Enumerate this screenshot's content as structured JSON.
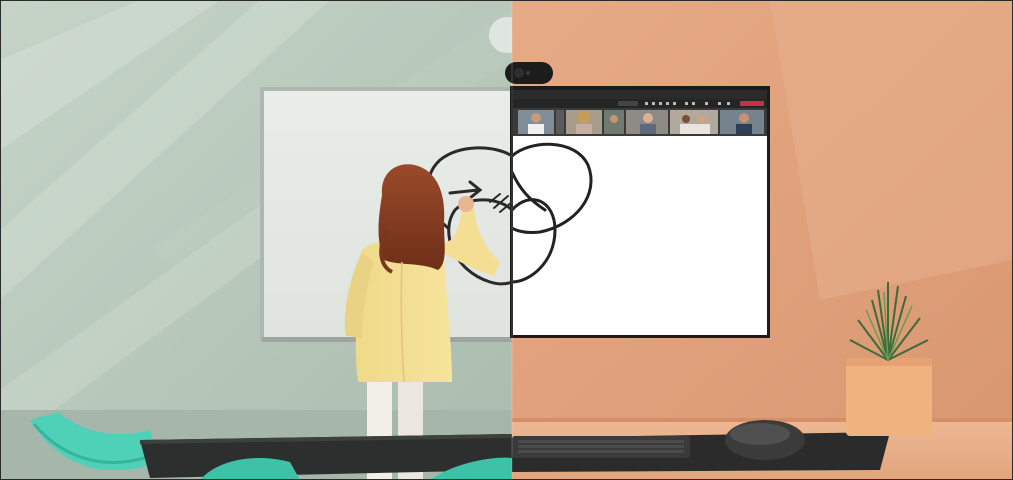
{
  "scene": {
    "left_room": {
      "wall_color": "#b8c9bc",
      "floor_color": "#aab9ae",
      "accent": "#4fd1b8"
    },
    "right_room": {
      "wall_color": "#e0a27c",
      "desk_color": "#e8b28e"
    },
    "meeting_window": {
      "participant_count": 7,
      "toolbar_icons": [
        "chat-icon",
        "people-icon",
        "reactions-icon",
        "view-icon",
        "more-icon",
        "camera-icon",
        "mic-icon",
        "share-icon"
      ]
    },
    "objects": [
      "whiteboard",
      "person-drawing",
      "conference-camera",
      "wall-monitor",
      "desk",
      "keyboard",
      "mouse",
      "mousepad",
      "potted-plant",
      "meeting-table",
      "chairs"
    ]
  }
}
